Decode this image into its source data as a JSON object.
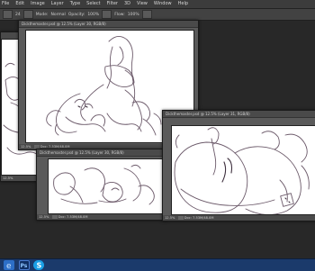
{
  "menubar": {
    "items": [
      "File",
      "Edit",
      "Image",
      "Layer",
      "Type",
      "Select",
      "Filter",
      "3D",
      "View",
      "Window",
      "Help"
    ]
  },
  "options": {
    "brush_size": "24",
    "mode_label": "Mode:",
    "mode_value": "Normal",
    "opacity_label": "Opacity:",
    "opacity_value": "100%",
    "flow_label": "Flow:",
    "flow_value": "100%"
  },
  "windows": {
    "main": {
      "title": "Dickthemaster.psd @ 12.5% (Layer 30, RGB/8)",
      "zoom": "12.5%",
      "doc": "Doc: 7.53M/48.0M"
    },
    "left": {
      "title": "",
      "zoom": "12.5%",
      "doc": "Doc: 7.53M/48.0M"
    },
    "bottom": {
      "title": "Dickthemaster.psd @ 12.5% (Layer 30, RGB/8)",
      "zoom": "12.5%",
      "doc": "Doc: 7.53M/48.0M"
    },
    "right": {
      "title": "Dickthemaster.psd @ 12.5% (Layer 31, RGB/8)",
      "zoom": "12.5%",
      "doc": "Doc: 7.53M/48.0M"
    }
  },
  "taskbar": {
    "buttons": [
      {
        "icon": "ie-icon",
        "color": "#4aa3ff"
      },
      {
        "icon": "photoshop-icon",
        "color": "#1c4f9c"
      },
      {
        "icon": "skype-icon",
        "color": "#1da0e0"
      }
    ]
  },
  "colors": {
    "workspace": "#282828",
    "window": "#5a5a5a",
    "taskbar": "#1b3a6b"
  }
}
